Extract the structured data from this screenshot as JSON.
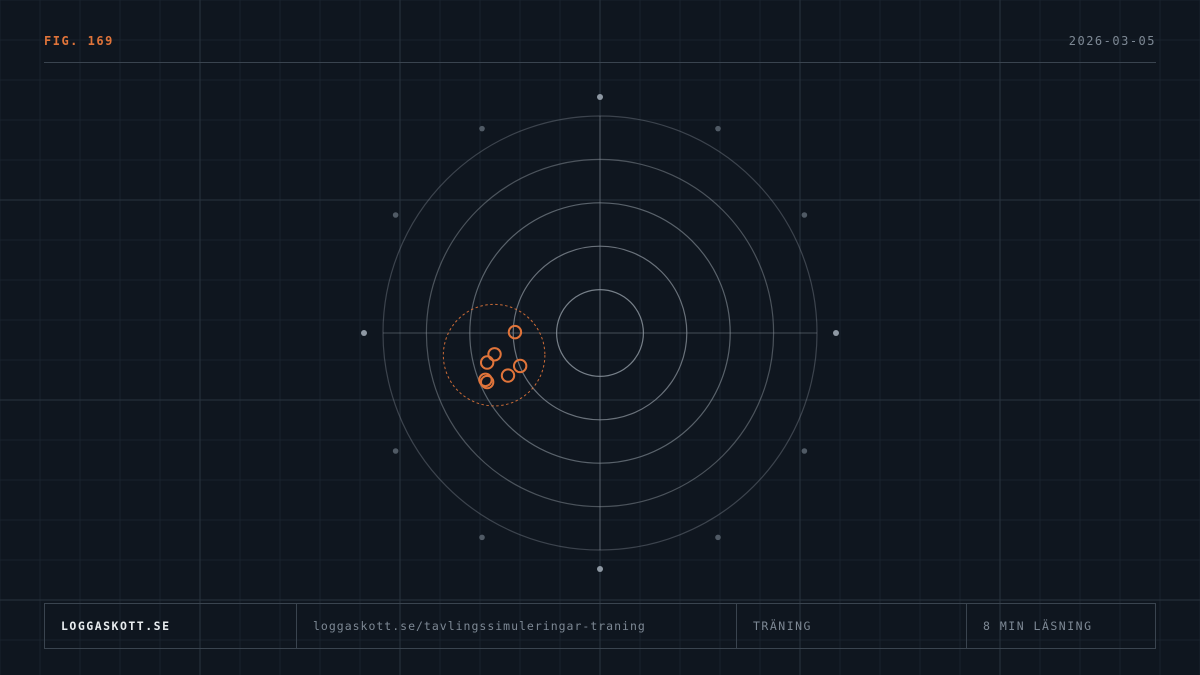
{
  "header": {
    "figure_label": "FIG. 169",
    "date": "2026-03-05"
  },
  "footer": {
    "site": "LOGGASKOTT.SE",
    "url": "loggaskott.se/tavlingssimuleringar-traning",
    "category": "TRÄNING",
    "read_time": "8 MIN LÄSNING"
  },
  "colors": {
    "background": "#0f161f",
    "accent": "#e0743a",
    "ring": "#8a939c",
    "text_muted": "#7d8894"
  },
  "target": {
    "rings": 5,
    "shots": [
      {
        "x": -1.96,
        "y": -0.02
      },
      {
        "x": -2.43,
        "y": 0.49
      },
      {
        "x": -2.6,
        "y": 0.68
      },
      {
        "x": -2.12,
        "y": 0.98
      },
      {
        "x": -1.84,
        "y": 0.76
      },
      {
        "x": -2.64,
        "y": 1.08
      },
      {
        "x": -2.6,
        "y": 1.13
      }
    ],
    "group": {
      "cx": -2.44,
      "cy": 0.51,
      "r": 1.17
    }
  }
}
